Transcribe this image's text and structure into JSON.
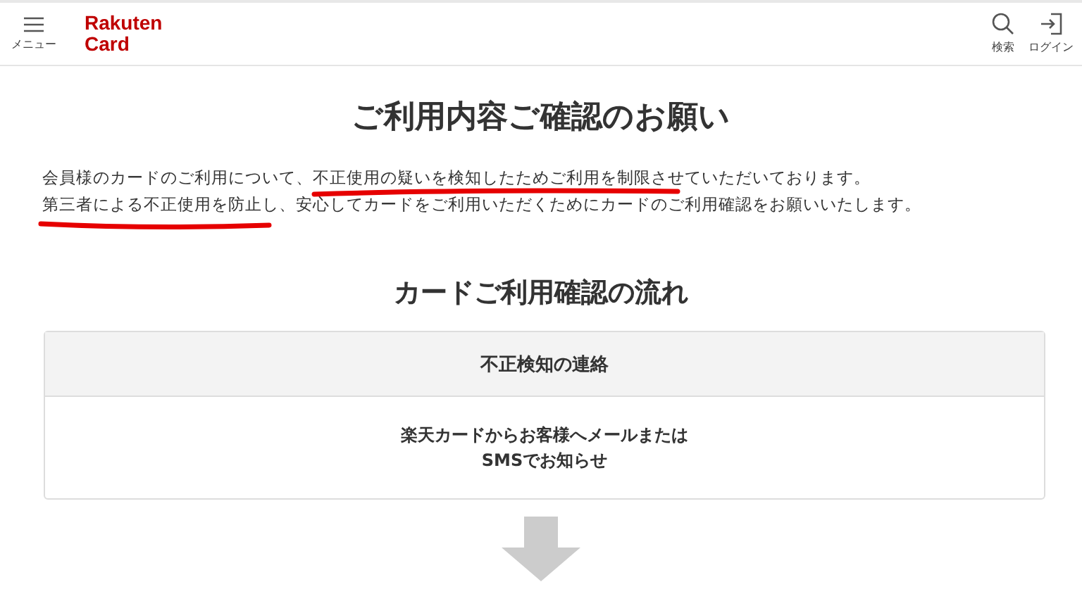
{
  "header": {
    "menu_label": "メニュー",
    "logo_lines": [
      "Rakuten",
      "Card"
    ],
    "actions": [
      {
        "kind": "search",
        "label": "検索"
      },
      {
        "kind": "login",
        "label": "ログイン"
      }
    ]
  },
  "title": "ご利用内容ご確認のお願い",
  "intro_lines": [
    "会員様のカードのご利用について、不正使用の疑いを検知したためご利用を制限させていただいております。",
    "第三者による不正使用を防止し、安心してカードをご利用いただくためにカードのご利用確認をお願いいたします。"
  ],
  "section_title": "カードご利用確認の流れ",
  "steps": [
    {
      "heading": "不正検知の連絡",
      "body_lines": [
        "楽天カードからお客様へメールまたは",
        "SMSでお知らせ"
      ]
    }
  ]
}
